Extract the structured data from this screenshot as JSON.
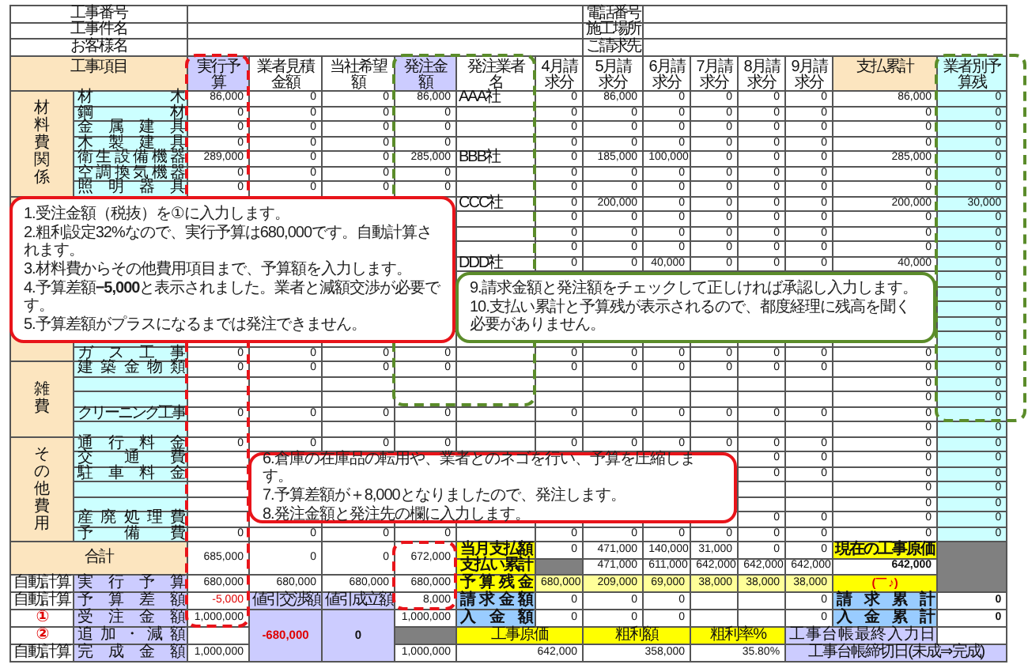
{
  "info_left": [
    {
      "label": "工事番号"
    },
    {
      "label": "工事件名"
    },
    {
      "label": "お客様名"
    }
  ],
  "info_right": [
    {
      "label": "電話番号"
    },
    {
      "label": "施工場所"
    },
    {
      "label": "ご請求先"
    }
  ],
  "columns": [
    "工事項目",
    "実行予算",
    "業者見積金額",
    "当社希望額",
    "発注金額",
    "発注業者名",
    "4月請求分",
    "5月請求分",
    "6月請求分",
    "7月請求分",
    "8月請求分",
    "9月請求分",
    "支払累計",
    "業者別予算残"
  ],
  "sections": [
    {
      "category": "材料費関係",
      "rows": [
        {
          "item": "材木",
          "cells": [
            "86,000",
            "0",
            "0",
            "86,000",
            "AAA社",
            "0",
            "86,000",
            "0",
            "0",
            "0",
            "0",
            "86,000",
            "0"
          ]
        },
        {
          "item": "鋼材",
          "cells": [
            "0",
            "0",
            "0",
            "0",
            null,
            "0",
            "0",
            "0",
            "0",
            "0",
            "0",
            "0",
            "0"
          ]
        },
        {
          "item": "金属建具",
          "cells": [
            "0",
            "0",
            "0",
            "0",
            null,
            "0",
            "0",
            "0",
            "0",
            "0",
            "0",
            "0",
            "0"
          ]
        },
        {
          "item": "木製建具",
          "cells": [
            "0",
            "0",
            "0",
            "0",
            null,
            "0",
            "0",
            "0",
            "0",
            "0",
            "0",
            "0",
            "0"
          ]
        },
        {
          "item": "衛生設備機器",
          "cells": [
            "289,000",
            "0",
            "0",
            "285,000",
            "BBB社",
            "0",
            "185,000",
            "100,000",
            "0",
            "0",
            "0",
            "285,000",
            "0"
          ]
        },
        {
          "item": "空調換気機器",
          "cells": [
            "0",
            "0",
            "0",
            "0",
            null,
            "0",
            "0",
            "0",
            "0",
            "0",
            "0",
            "0",
            "0"
          ]
        },
        {
          "item": "照明器具",
          "cells": [
            "0",
            "0",
            "0",
            "0",
            null,
            "0",
            "0",
            "0",
            "0",
            "0",
            "0",
            "0",
            "0"
          ]
        }
      ]
    },
    {
      "rows": [
        {
          "cells": [
            null,
            null,
            null,
            null,
            "CCC社",
            "0",
            "200,000",
            "0",
            "0",
            "0",
            "0",
            "200,000",
            "30,000"
          ]
        },
        {
          "cells": [
            null,
            null,
            null,
            null,
            null,
            "0",
            "0",
            "0",
            "0",
            "0",
            "0",
            "0",
            "0"
          ]
        },
        {
          "cells": [
            null,
            null,
            null,
            null,
            null,
            "0",
            "0",
            "0",
            "0",
            "0",
            "0",
            "0",
            "0"
          ]
        },
        {
          "cells": [
            null,
            null,
            null,
            null,
            null,
            "0",
            "0",
            "0",
            "0",
            "0",
            "0",
            "0",
            "0"
          ]
        },
        {
          "cells": [
            null,
            null,
            null,
            null,
            "DDD社",
            "0",
            "0",
            "40,000",
            "0",
            "0",
            "0",
            "40,000",
            "0"
          ]
        },
        {
          "cells": [
            null,
            null,
            null,
            null,
            null,
            null,
            null,
            null,
            null,
            null,
            null,
            null,
            "0"
          ]
        },
        {
          "cells": [
            null,
            null,
            null,
            null,
            null,
            null,
            null,
            null,
            null,
            null,
            null,
            null,
            "0"
          ]
        },
        {
          "cells": [
            null,
            null,
            null,
            null,
            null,
            null,
            null,
            null,
            null,
            null,
            null,
            null,
            "0"
          ]
        },
        {
          "cells": [
            null,
            null,
            null,
            null,
            null,
            null,
            null,
            null,
            null,
            null,
            null,
            null,
            "0"
          ]
        },
        {
          "cells": [
            null,
            null,
            null,
            null,
            null,
            null,
            null,
            null,
            null,
            null,
            null,
            null,
            "0"
          ]
        },
        {
          "item": "ガス工事",
          "cells": [
            "0",
            "0",
            "0",
            "0",
            null,
            "0",
            "0",
            "0",
            "0",
            "0",
            "0",
            "0",
            "0"
          ]
        }
      ]
    },
    {
      "category": "雑費",
      "rows": [
        {
          "item": "建築金物類",
          "cells": [
            "0",
            "0",
            "0",
            "0",
            null,
            "0",
            "0",
            "0",
            "0",
            "0",
            "0",
            "0",
            "0"
          ]
        },
        {
          "cells": [
            null,
            null,
            null,
            null,
            null,
            null,
            null,
            null,
            null,
            null,
            null,
            "0",
            "0"
          ]
        },
        {
          "cells": [
            null,
            null,
            null,
            null,
            null,
            null,
            null,
            null,
            null,
            null,
            null,
            "0",
            "0"
          ]
        },
        {
          "item": "クリーニング工事",
          "cells": [
            "0",
            "0",
            "0",
            "0",
            null,
            "0",
            "0",
            "0",
            "0",
            "0",
            "0",
            "0",
            "0"
          ]
        },
        {
          "cells": [
            null,
            null,
            null,
            null,
            null,
            null,
            null,
            null,
            null,
            null,
            null,
            "0",
            "0"
          ]
        }
      ]
    },
    {
      "category": "その他費用",
      "rows": [
        {
          "item": "通行料金",
          "cells": [
            "0",
            "0",
            "0",
            "0",
            null,
            "0",
            "0",
            "0",
            "0",
            "0",
            "0",
            "0",
            "0"
          ]
        },
        {
          "item": "交通費",
          "cells": [
            null,
            null,
            null,
            null,
            null,
            null,
            null,
            null,
            null,
            "0",
            "0",
            "0",
            "0"
          ]
        },
        {
          "item": "駐車料金",
          "cells": [
            null,
            null,
            null,
            null,
            null,
            null,
            null,
            null,
            null,
            "0",
            "0",
            "0",
            "0"
          ]
        },
        {
          "cells": [
            null,
            null,
            null,
            null,
            null,
            null,
            null,
            null,
            null,
            null,
            null,
            "0",
            "0"
          ]
        },
        {
          "cells": [
            null,
            null,
            null,
            null,
            null,
            null,
            null,
            null,
            null,
            null,
            null,
            "0",
            "0"
          ]
        },
        {
          "item": "産廃処理費",
          "cells": [
            null,
            null,
            null,
            null,
            null,
            null,
            null,
            null,
            null,
            "0",
            "0",
            "0",
            "0"
          ]
        },
        {
          "item": "予備費",
          "cells": [
            "0",
            "0",
            "0",
            "0",
            null,
            "0",
            "0",
            "0",
            "0",
            "0",
            "0",
            "0",
            "0"
          ]
        }
      ]
    }
  ],
  "total": {
    "label": "合計",
    "cells": [
      "685,000",
      "0",
      "0",
      "672,000"
    ],
    "monthly_label": "当月支払額",
    "monthly": [
      "0",
      "471,000",
      "140,000",
      "31,000",
      "0",
      "0"
    ],
    "cost_label": "現在の工事原価",
    "cumulative_label": "支払い累計",
    "cumulative": [
      "471,000",
      "611,000",
      "642,000",
      "642,000",
      "642,000"
    ],
    "cost": "642,000"
  },
  "exec_row": {
    "tag": "自動計算",
    "kind": "auto",
    "label": "実行予算",
    "cells": [
      "680,000",
      "680,000",
      "680,000",
      "680,000"
    ],
    "remain_label": "予算残金",
    "remain": [
      "680,000",
      "209,000",
      "69,000",
      "38,000",
      "38,000",
      "38,000"
    ],
    "face": "(￣♪)"
  },
  "diff_row": {
    "tag": "自動計算",
    "kind": "auto",
    "label": "予算差額",
    "value": "-5,000",
    "nego_label": "値引交渉額",
    "agreed_label": "値引成立額",
    "order_diff": "8,000",
    "billing_label": "請求金額",
    "billing": [
      "0",
      "0",
      "0"
    ],
    "billing_last": "0",
    "billing_total_label": "請求累計",
    "billing_total": "0"
  },
  "order_row": {
    "tag": "①",
    "kind": "input",
    "label": "受注金額",
    "value": "1,000,000",
    "nego": "-680,000",
    "agreed": "0",
    "order_value": "1,000,000",
    "deposit_label": "入金額",
    "deposit": [
      "0",
      "0",
      "0"
    ],
    "deposit_last": "0",
    "deposit_total_label": "入金累計",
    "deposit_total": "0"
  },
  "adjust_row": {
    "tag": "②",
    "kind": "input",
    "label": "追加・減額",
    "cost_label": "工事原価",
    "profit_label": "粗利額",
    "rate_label": "粗利率%",
    "last_input_label": "工事台帳最終入力日"
  },
  "complete_row": {
    "tag": "自動計算",
    "kind": "auto",
    "label": "完成金額",
    "value": "1,000,000",
    "order_value": "1,000,000",
    "cost": "642,000",
    "profit": "358,000",
    "rate": "35.80%",
    "closing_label": "工事台帳締切日(未成⇒完成)"
  },
  "frames": [
    {
      "color": "#e8141a"
    },
    {
      "color": "#5b8c2a"
    },
    {
      "color": "#5b8c2a"
    },
    {
      "color": "#e8141a"
    }
  ],
  "callouts": [
    {
      "color": "#e8141a",
      "lines": [
        "1.受注金額（税抜）を①に入力します。",
        "2.粗利設定32%なので、実行予算は680,000です。自動計算されます。",
        "3.材料費からその他費用項目まで、予算額を入力します。",
        "4.予算差額**−5,000**と表示されました。業者と減額交渉が必要です。",
        "5.予算差額がプラスになるまでは発注できません。"
      ]
    },
    {
      "color": "#5b8c2a",
      "lines": [
        "9.請求金額と発注額をチェックして正しければ承認し入力します。",
        "10.支払い累計と予算残が表示されるので、都度経理に残高を聞く必要がありません。"
      ]
    },
    {
      "color": "#e8141a",
      "lines": [
        "6.倉庫の在庫品の転用や、業者とのネゴを行い、予算を圧縮します。",
        "7.予算差額が＋8,000となりましたので、発注します。",
        "8.発注金額と発注先の欄に入力します。"
      ]
    }
  ]
}
